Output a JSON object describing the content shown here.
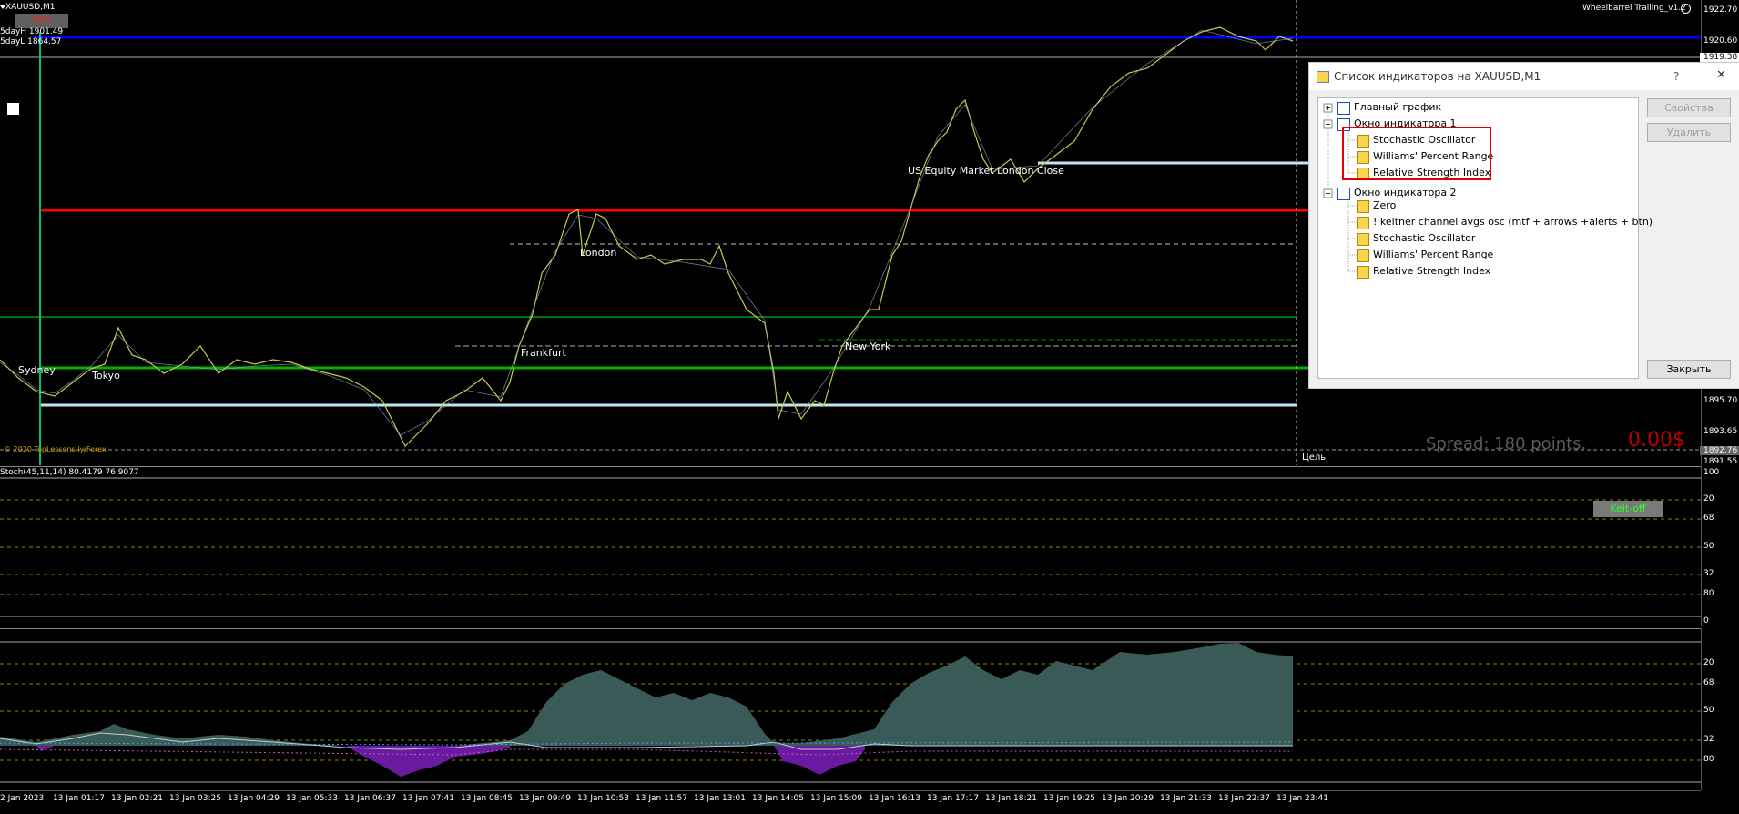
{
  "chart": {
    "symbol": "XAUUSD,M1",
    "esr_label": "ESR",
    "day_high": "5dayH 1901.49",
    "day_low": "5dayL 1864.57",
    "ea_name": "Wheelbarrel Trailing_v1.2",
    "copyright": "© 2020 TopLessons.ly/Forex",
    "spread": "Spread: 180 points.",
    "profit": "0.00$",
    "target_label": "Цель",
    "sessions": {
      "sydney": "Sydney",
      "tokyo": "Tokyo",
      "frankfurt": "Frankfurt",
      "london": "London",
      "new_york": "New York",
      "london_close": "US Equity Market London Close"
    },
    "price_scale": [
      "1922.70",
      "1920.60",
      "1919.38",
      "1895.70",
      "1893.65",
      "1892.76",
      "1891.55"
    ]
  },
  "stoch_panel": {
    "label": "Stoch(45,11,14) 80.4179 76.9077",
    "kelt_button": "Kelt-off",
    "scale": [
      "100",
      "20",
      "68",
      "50",
      "32",
      "80",
      "0"
    ]
  },
  "osc_panel": {
    "scale": [
      "20",
      "68",
      "50",
      "32",
      "80"
    ]
  },
  "time_axis": [
    "2 Jan 2023",
    "13 Jan 01:17",
    "13 Jan 02:21",
    "13 Jan 03:25",
    "13 Jan 04:29",
    "13 Jan 05:33",
    "13 Jan 06:37",
    "13 Jan 07:41",
    "13 Jan 08:45",
    "13 Jan 09:49",
    "13 Jan 10:53",
    "13 Jan 11:57",
    "13 Jan 13:01",
    "13 Jan 14:05",
    "13 Jan 15:09",
    "13 Jan 16:13",
    "13 Jan 17:17",
    "13 Jan 18:21",
    "13 Jan 19:25",
    "13 Jan 20:29",
    "13 Jan 21:33",
    "13 Jan 22:37",
    "13 Jan 23:41"
  ],
  "dialog": {
    "title": "Список индикаторов на XAUUSD,M1",
    "help": "?",
    "close_x": "✕",
    "tree": {
      "main_chart": "Главный график",
      "window1": "Окно индикатора 1",
      "window1_items": [
        "Stochastic Oscillator",
        "Williams' Percent Range",
        "Relative Strength Index"
      ],
      "window2": "Окно индикатора 2",
      "window2_items": [
        "Zero",
        "! keltner channel avgs osc (mtf + arrows +alerts + btn)",
        "Stochastic Oscillator",
        "Williams' Percent Range",
        "Relative Strength Index"
      ]
    },
    "buttons": {
      "properties": "Свойства",
      "delete": "Удалить",
      "close": "Закрыть"
    }
  },
  "colors": {
    "background": "#000000",
    "price_line": "#c8c850",
    "blue_level": "#0000ff",
    "red_level": "#ff0000",
    "green_level": "#00a000",
    "light_level": "#bfe6ef",
    "osc_fill": "#3a5a58",
    "osc_neg": "#6a1aa0",
    "highlight_box": "#e00000"
  }
}
